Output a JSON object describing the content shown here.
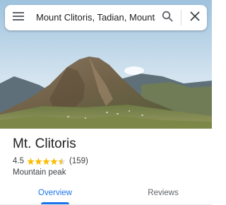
{
  "search": {
    "query": "Mount Clitoris, Tadian, Mountain Province",
    "menu_icon": "menu-icon",
    "search_icon": "search-icon",
    "close_icon": "close-icon"
  },
  "place": {
    "title": "Mt. Clitoris",
    "rating": "4.5",
    "rating_value": 4.5,
    "review_count": "(159)",
    "type": "Mountain peak"
  },
  "tabs": [
    {
      "label": "Overview",
      "selected": true
    },
    {
      "label": "Reviews",
      "selected": false
    }
  ],
  "colors": {
    "accent": "#1a73e8",
    "star": "#fbbc04",
    "sky": "#c9dcea"
  }
}
